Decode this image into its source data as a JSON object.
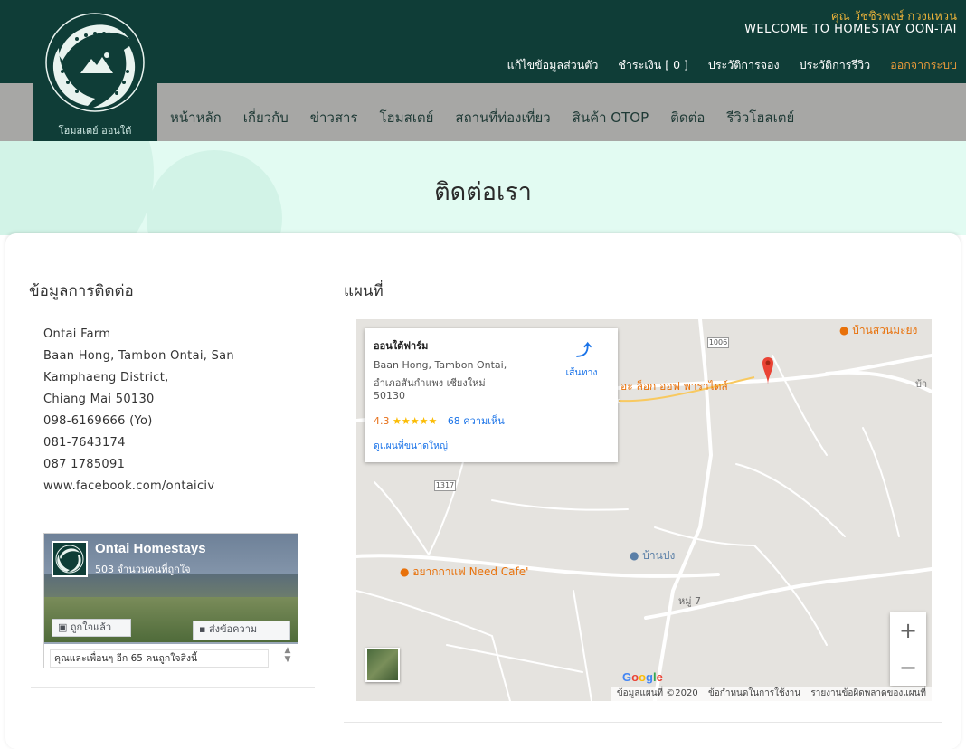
{
  "header": {
    "logo_text": "โฮมสเตย์ ออนใต้",
    "user_name": "คุณ วัชชิรพงษ์ กวงแหวน",
    "welcome": "WELCOME TO HOMESTAY OON-TAI",
    "account_links": {
      "edit_profile": "แก้ไขข้อมูลส่วนตัว",
      "payment": "ชำระเงิน [ 0 ]",
      "booking_history": "ประวัติการจอง",
      "review_history": "ประวัติการรีวิว",
      "logout": "ออกจากระบบ"
    },
    "colors": {
      "header_bg": "#0f3d37",
      "nav_bg": "#a7a7a5",
      "logout": "#e89a3a",
      "user_name": "#e8b13a"
    }
  },
  "nav": {
    "home": "หน้าหลัก",
    "about": "เกี่ยวกับ",
    "news": "ข่าวสาร",
    "homestay": "โฮมสเตย์",
    "attractions": "สถานที่ท่องเที่ยว",
    "otop": "สินค้า OTOP",
    "contact": "ติดต่อ",
    "reviews": "รีวิวโฮสเตย์"
  },
  "hero": {
    "title": "ติดต่อเรา",
    "bg_color": "#e2fbf2"
  },
  "contact": {
    "heading": "ข้อมูลการติดต่อ",
    "lines": [
      "Ontai Farm",
      "Baan Hong, Tambon Ontai, San",
      "Kamphaeng District,",
      "Chiang Mai 50130",
      "098-6169666 (Yo)",
      "081-7643174",
      "087 1785091",
      "www.facebook.com/ontaiciv"
    ]
  },
  "facebook": {
    "page_name": "Ontai Homestays",
    "likes": "503 จำนวนคนที่ถูกใจ",
    "liked_button": "ถูกใจแล้ว",
    "message_button": "ส่งข้อความ",
    "friends_text": "คุณและเพื่อนๆ อีก 65 คนถูกใจสิ่งนี้"
  },
  "map": {
    "heading": "แผนที่",
    "place_name": "ออนใต้ฟาร์ม",
    "address_1": "Baan Hong, Tambon Ontai,",
    "address_2": "อำเภอสันกำแพง เชียงใหม่",
    "address_3": "50130",
    "rating": "4.3",
    "stars": "★★★★★",
    "reviews": "68 ความเห็น",
    "view_larger": "ดูแผนที่ขนาดใหญ่",
    "directions": "เส้นทาง",
    "labels": {
      "ban_suan": "บ้านสวนมะยง",
      "resort": "อะ ล็อก ออฟ พาราไดส์",
      "cafe": "อยากกาแฟ Need Cafe'",
      "ban_pong": "บ้านปง",
      "moo7": "หมู่ 7",
      "ban_edge": "บ้า",
      "road_1006": "1006",
      "road_1317": "1317"
    },
    "google": "Google",
    "attribution": {
      "data": "ข้อมูลแผนที่ ©2020",
      "terms": "ข้อกำหนดในการใช้งาน",
      "report": "รายงานข้อผิดพลาดของแผนที่"
    },
    "zoom_in": "+",
    "zoom_out": "−"
  }
}
